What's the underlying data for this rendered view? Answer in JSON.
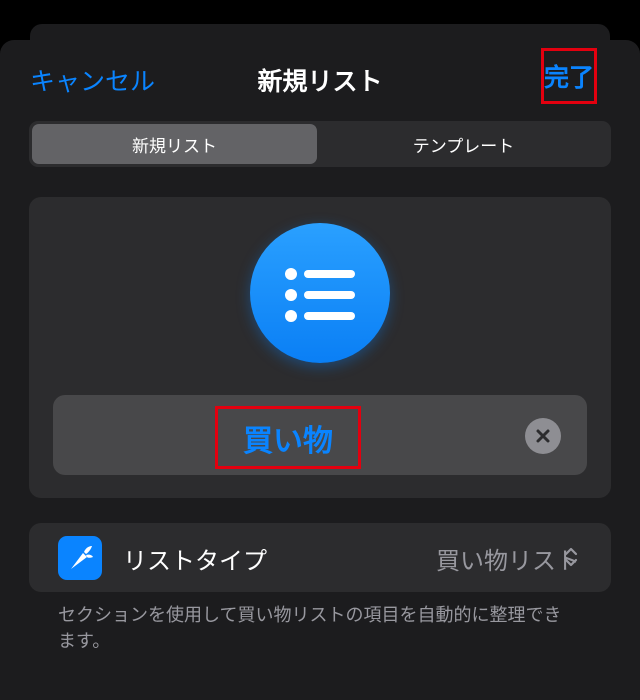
{
  "nav": {
    "cancel": "キャンセル",
    "title": "新規リスト",
    "done": "完了"
  },
  "segmented": {
    "options": [
      "新規リスト",
      "テンプレート"
    ],
    "selected": "新規リスト"
  },
  "list_icon": {
    "icon": "list-bullet-icon",
    "color": "#0a84ff"
  },
  "name_field": {
    "value": "買い物",
    "clear_icon": "clear-circle-icon"
  },
  "list_type": {
    "icon": "carrot-icon",
    "label": "リストタイプ",
    "value": "買い物リスト"
  },
  "footnote": "セクションを使用して買い物リストの項目を自動的に整理できます。",
  "colors": {
    "accent": "#0a84ff",
    "highlight": "#e3000f",
    "background": "#1c1c1e"
  }
}
